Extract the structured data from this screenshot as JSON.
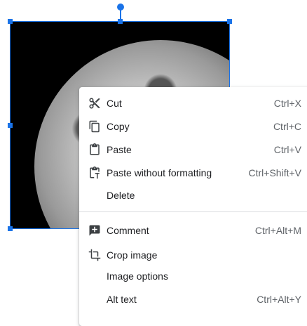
{
  "menu": {
    "items": [
      {
        "label": "Cut",
        "shortcut": "Ctrl+X",
        "icon": "scissors-icon"
      },
      {
        "label": "Copy",
        "shortcut": "Ctrl+C",
        "icon": "copy-icon"
      },
      {
        "label": "Paste",
        "shortcut": "Ctrl+V",
        "icon": "clipboard-icon"
      },
      {
        "label": "Paste without formatting",
        "shortcut": "Ctrl+Shift+V",
        "icon": "clipboard-text-icon"
      },
      {
        "label": "Delete",
        "shortcut": "",
        "icon": ""
      },
      {
        "label": "Comment",
        "shortcut": "Ctrl+Alt+M",
        "icon": "add-comment-icon"
      },
      {
        "label": "Crop image",
        "shortcut": "",
        "icon": "crop-icon"
      },
      {
        "label": "Image options",
        "shortcut": "",
        "icon": ""
      },
      {
        "label": "Alt text",
        "shortcut": "Ctrl+Alt+Y",
        "icon": ""
      }
    ]
  },
  "colors": {
    "selection": "#1a73e8",
    "menu_text": "#202124",
    "shortcut_text": "#5f6368"
  }
}
